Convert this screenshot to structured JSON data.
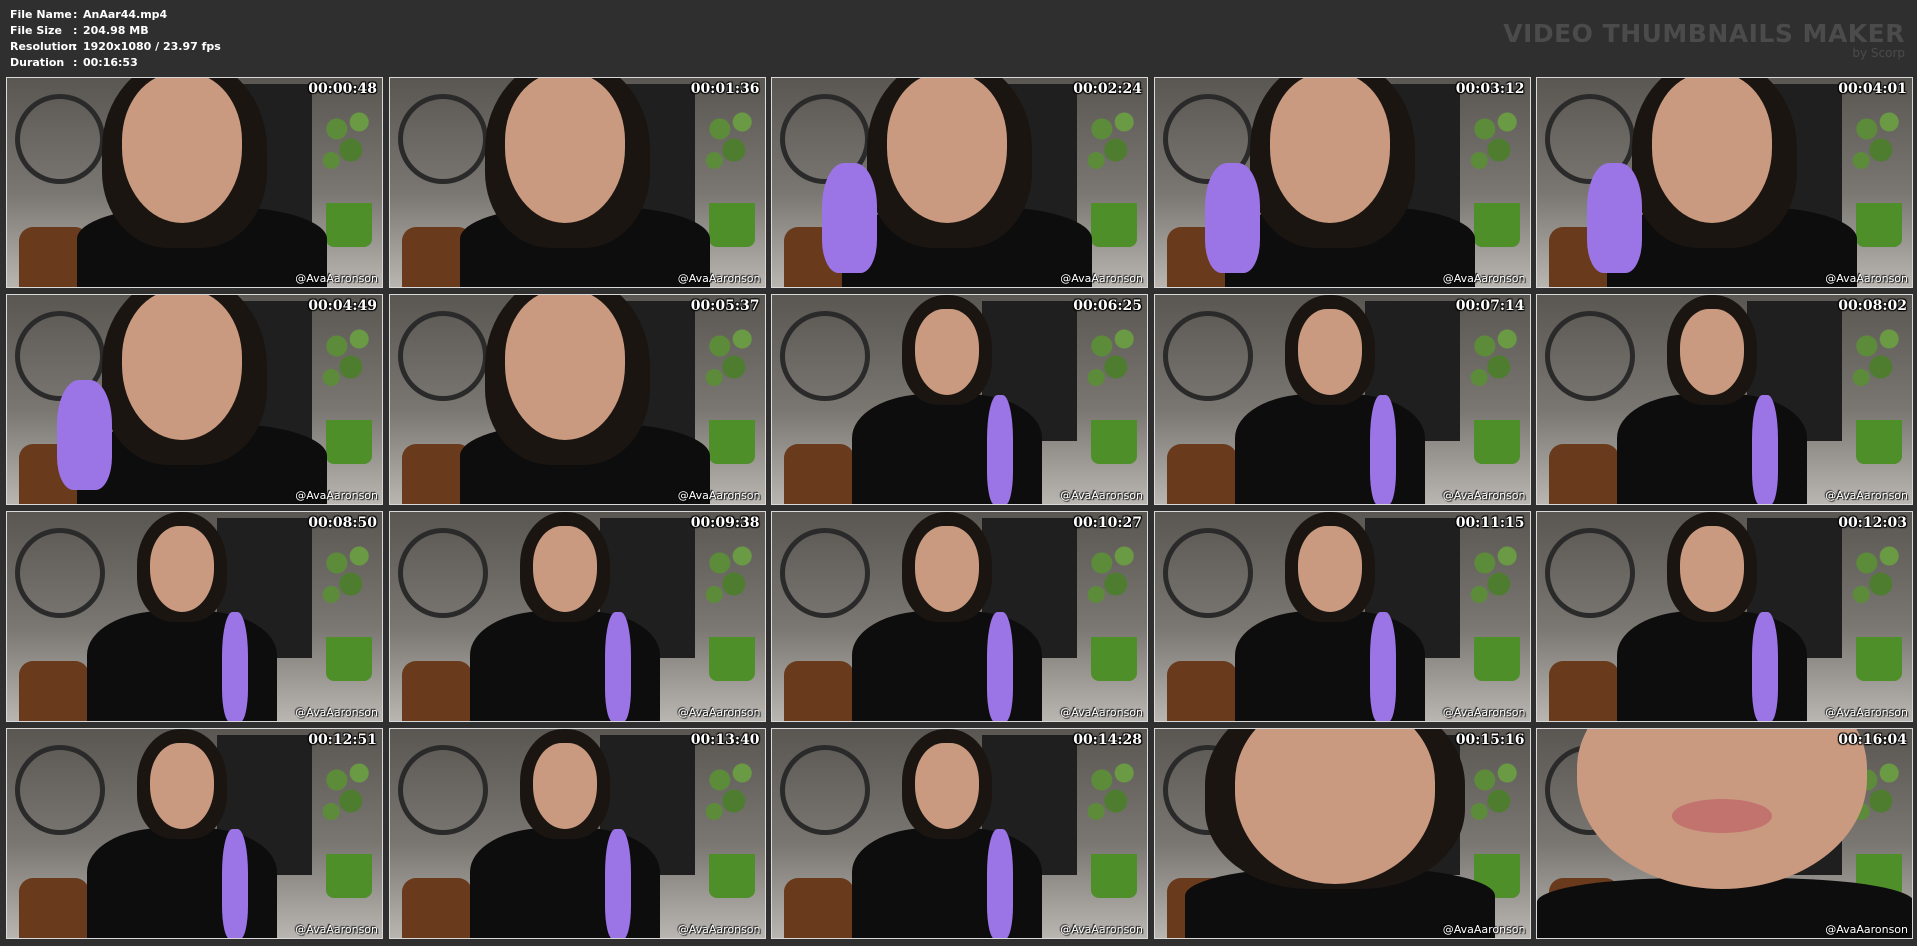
{
  "meta": {
    "file_name_label": "File Name",
    "file_name": "AnAar44.mp4",
    "file_size_label": "File Size",
    "file_size": "204.98 MB",
    "resolution_label": "Resolution",
    "resolution": "1920x1080 / 23.97 fps",
    "duration_label": "Duration",
    "duration": "00:16:53",
    "separator": ":"
  },
  "brand": {
    "title": "VIDEO THUMBNAILS MAKER",
    "subtitle": "by Scorp"
  },
  "watermark": "@AvaAaronson",
  "thumbnails": [
    {
      "timestamp": "00:00:48",
      "shot": "closeup"
    },
    {
      "timestamp": "00:01:36",
      "shot": "closeup"
    },
    {
      "timestamp": "00:02:24",
      "shot": "closeup-toy"
    },
    {
      "timestamp": "00:03:12",
      "shot": "closeup-toy"
    },
    {
      "timestamp": "00:04:01",
      "shot": "closeup-toy"
    },
    {
      "timestamp": "00:04:49",
      "shot": "closeup-toy"
    },
    {
      "timestamp": "00:05:37",
      "shot": "closeup"
    },
    {
      "timestamp": "00:06:25",
      "shot": "medium-toy"
    },
    {
      "timestamp": "00:07:14",
      "shot": "medium-toy"
    },
    {
      "timestamp": "00:08:02",
      "shot": "medium-toy"
    },
    {
      "timestamp": "00:08:50",
      "shot": "medium-toy"
    },
    {
      "timestamp": "00:09:38",
      "shot": "medium-toy"
    },
    {
      "timestamp": "00:10:27",
      "shot": "medium-toy"
    },
    {
      "timestamp": "00:11:15",
      "shot": "medium-toy"
    },
    {
      "timestamp": "00:12:03",
      "shot": "medium-toy"
    },
    {
      "timestamp": "00:12:51",
      "shot": "medium-toy"
    },
    {
      "timestamp": "00:13:40",
      "shot": "medium-toy"
    },
    {
      "timestamp": "00:14:28",
      "shot": "medium-toy"
    },
    {
      "timestamp": "00:15:16",
      "shot": "extreme-closeup"
    },
    {
      "timestamp": "00:16:04",
      "shot": "lips-closeup"
    }
  ],
  "colors": {
    "background": "#2f2f2f",
    "brand_text": "#4b4b4b",
    "thumb_border": "#d9d9d9",
    "toy": "#9b74e6"
  }
}
